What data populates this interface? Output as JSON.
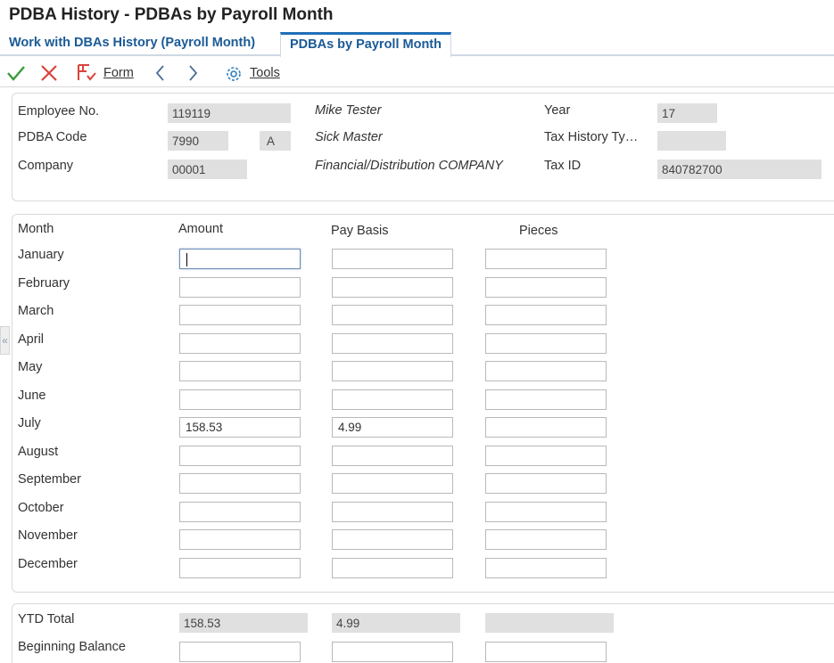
{
  "title": "PDBA History - PDBAs by Payroll Month",
  "tabs": {
    "work": "Work with DBAs History (Payroll Month)",
    "pdba": "PDBAs by Payroll Month"
  },
  "toolbar": {
    "form_label": "Form",
    "tools_label": "Tools"
  },
  "header": {
    "employee_no_label": "Employee No.",
    "employee_no": "119119",
    "employee_name": "Mike Tester",
    "pdba_code_label": "PDBA Code",
    "pdba_code": "7990",
    "pdba_type": "A",
    "pdba_description": "Sick Master",
    "company_label": "Company",
    "company": "00001",
    "company_name": "Financial/Distribution COMPANY",
    "year_label": "Year",
    "year": "17",
    "tax_history_label": "Tax History Ty…",
    "tax_history": "",
    "tax_id_label": "Tax ID",
    "tax_id": "840782700"
  },
  "grid": {
    "col_month": "Month",
    "col_amount": "Amount",
    "col_pay_basis": "Pay Basis",
    "col_pieces": "Pieces",
    "rows": [
      {
        "month": "January",
        "amount": "",
        "pay_basis": "",
        "pieces": ""
      },
      {
        "month": "February",
        "amount": "",
        "pay_basis": "",
        "pieces": ""
      },
      {
        "month": "March",
        "amount": "",
        "pay_basis": "",
        "pieces": ""
      },
      {
        "month": "April",
        "amount": "",
        "pay_basis": "",
        "pieces": ""
      },
      {
        "month": "May",
        "amount": "",
        "pay_basis": "",
        "pieces": ""
      },
      {
        "month": "June",
        "amount": "",
        "pay_basis": "",
        "pieces": ""
      },
      {
        "month": "July",
        "amount": "158.53",
        "pay_basis": "4.99",
        "pieces": ""
      },
      {
        "month": "August",
        "amount": "",
        "pay_basis": "",
        "pieces": ""
      },
      {
        "month": "September",
        "amount": "",
        "pay_basis": "",
        "pieces": ""
      },
      {
        "month": "October",
        "amount": "",
        "pay_basis": "",
        "pieces": ""
      },
      {
        "month": "November",
        "amount": "",
        "pay_basis": "",
        "pieces": ""
      },
      {
        "month": "December",
        "amount": "",
        "pay_basis": "",
        "pieces": ""
      }
    ]
  },
  "ytd": {
    "label": "YTD Total",
    "amount": "158.53",
    "pay_basis": "4.99",
    "pieces": "",
    "beginning_balance_label": "Beginning Balance"
  }
}
